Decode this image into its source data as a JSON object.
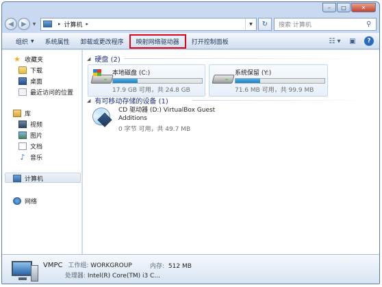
{
  "window": {
    "caption": {
      "minimize": "–",
      "maximize": "□",
      "close": "✕"
    }
  },
  "address": {
    "back": "◀",
    "forward": "▶",
    "crumb_sep": "▸",
    "path": "计算机",
    "path_sep": "▸",
    "refresh": "↻",
    "search_placeholder": "搜索 计算机",
    "search_icon": "magnifier-icon"
  },
  "toolbar": {
    "organize": "组织",
    "system_properties": "系统属性",
    "uninstall": "卸载或更改程序",
    "map_drive": "映射网络驱动器",
    "control_panel": "打开控制面板",
    "view_icon": "view-options-icon",
    "preview_icon": "preview-pane-icon",
    "help_icon": "?"
  },
  "nav": {
    "favorites": "收藏夹",
    "downloads": "下载",
    "desktop": "桌面",
    "recent": "最近访问的位置",
    "libraries": "库",
    "videos": "视频",
    "pictures": "图片",
    "documents": "文档",
    "music": "音乐",
    "computer": "计算机",
    "network": "网络"
  },
  "content": {
    "hdd_group": "硬盘 (2)",
    "removable_group": "有可移动存储的设备 (1)",
    "drives": [
      {
        "name": "本地磁盘 (C:)",
        "size": "17.9 GB 可用，共 24.8 GB",
        "used_fraction": 0.28
      },
      {
        "name": "系统保留 (Y:)",
        "size": "71.6 MB 可用，共 99.9 MB",
        "used_fraction": 0.28
      }
    ],
    "cd": {
      "name": "CD 驱动器 (D:) VirtualBox Guest Additions",
      "size": "0 字节 可用，共 49.7 MB"
    }
  },
  "details": {
    "computer_name": "VMPC",
    "workgroup_label": "工作组:",
    "workgroup": "WORKGROUP",
    "memory_label": "内存:",
    "memory": "512 MB",
    "cpu_label": "处理器:",
    "cpu": "Intel(R) Core(TM) i3 C..."
  },
  "colors": {
    "highlight_border": "#e2001a",
    "group_header": "#1e3287",
    "capacity_bar": "#1f7fbd"
  }
}
